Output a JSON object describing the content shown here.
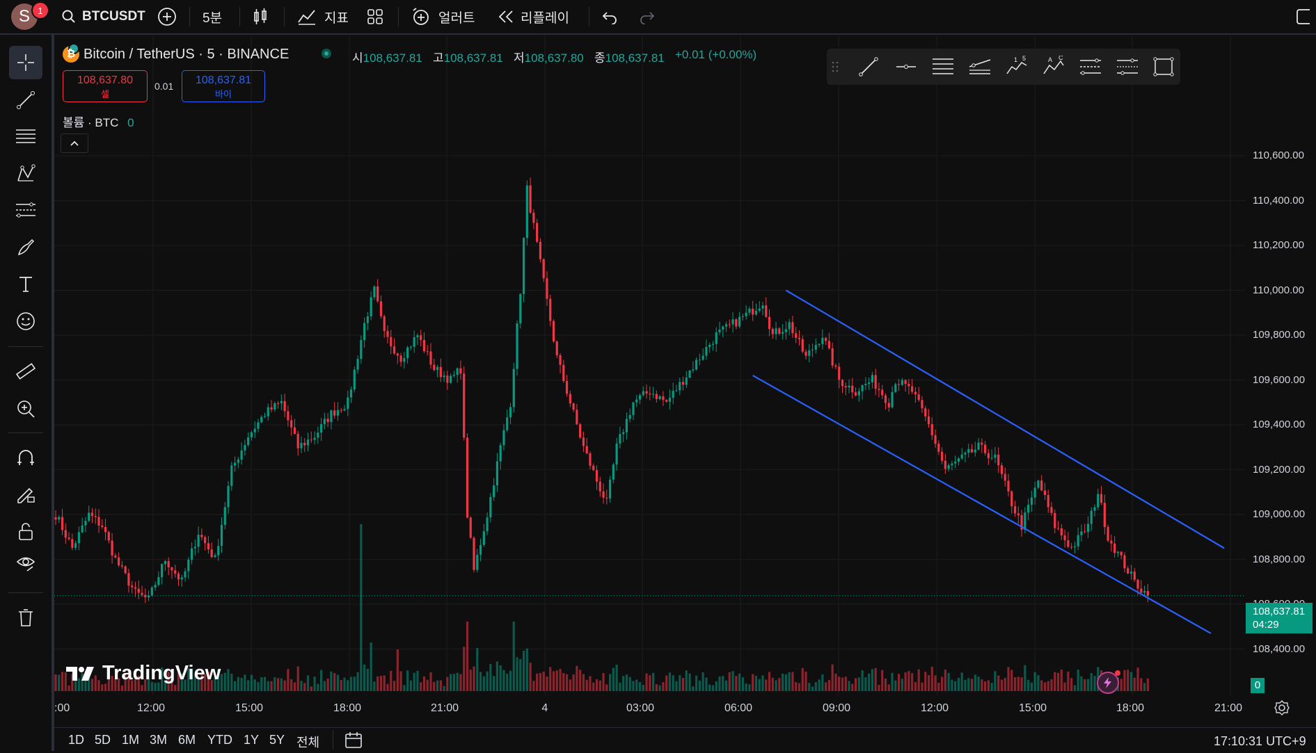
{
  "topbar": {
    "avatar_initial": "S",
    "notification_count": "1",
    "symbol": "BTCUSDT",
    "interval": "5분",
    "indicators_label": "지표",
    "alert_label": "얼러트",
    "replay_label": "리플레이"
  },
  "legend": {
    "title": "Bitcoin / TetherUS · 5 · BINANCE",
    "open_key": "시",
    "open": "108,637.81",
    "high_key": "고",
    "high": "108,637.81",
    "low_key": "저",
    "low": "108,637.80",
    "close_key": "종",
    "close": "108,637.81",
    "change": "+0.01 (+0.00%)",
    "sell_price": "108,637.80",
    "sell_label": "셀",
    "spread": "0.01",
    "buy_price": "108,637.81",
    "buy_label": "바이",
    "volume_label": "볼륨 · BTC",
    "volume_value": "0"
  },
  "chart_data": {
    "type": "candlestick",
    "title": "Bitcoin / TetherUS · 5 · BINANCE",
    "y_ticks": [
      108400,
      108600,
      108800,
      109000,
      109200,
      109400,
      109600,
      109800,
      110000,
      110200,
      110400,
      110600
    ],
    "y_range": [
      108350,
      110700
    ],
    "x_ticks": [
      "12:00",
      "15:00",
      "18:00",
      "21:00",
      "4",
      "03:00",
      "06:00",
      "09:00",
      "12:00",
      "15:00",
      "18:00",
      "21:00"
    ],
    "keyframes": [
      [
        0,
        109000
      ],
      [
        5,
        108850
      ],
      [
        10,
        109000
      ],
      [
        14,
        108950
      ],
      [
        18,
        108800
      ],
      [
        24,
        108650
      ],
      [
        28,
        108620
      ],
      [
        33,
        108800
      ],
      [
        38,
        108700
      ],
      [
        43,
        108920
      ],
      [
        48,
        108800
      ],
      [
        53,
        109200
      ],
      [
        58,
        109350
      ],
      [
        63,
        109450
      ],
      [
        68,
        109500
      ],
      [
        73,
        109300
      ],
      [
        78,
        109350
      ],
      [
        83,
        109450
      ],
      [
        88,
        109500
      ],
      [
        93,
        109850
      ],
      [
        96,
        110000
      ],
      [
        99,
        109800
      ],
      [
        104,
        109700
      ],
      [
        109,
        109800
      ],
      [
        114,
        109650
      ],
      [
        119,
        109600
      ],
      [
        122,
        109650
      ],
      [
        124,
        109000
      ],
      [
        126,
        108750
      ],
      [
        130,
        109000
      ],
      [
        134,
        109300
      ],
      [
        137,
        109500
      ],
      [
        140,
        110000
      ],
      [
        142,
        110450
      ],
      [
        145,
        110200
      ],
      [
        148,
        109950
      ],
      [
        151,
        109700
      ],
      [
        155,
        109500
      ],
      [
        159,
        109300
      ],
      [
        163,
        109150
      ],
      [
        166,
        109050
      ],
      [
        169,
        109300
      ],
      [
        174,
        109500
      ],
      [
        179,
        109550
      ],
      [
        184,
        109500
      ],
      [
        189,
        109600
      ],
      [
        194,
        109700
      ],
      [
        199,
        109800
      ],
      [
        204,
        109850
      ],
      [
        209,
        109900
      ],
      [
        213,
        109950
      ],
      [
        216,
        109800
      ],
      [
        221,
        109850
      ],
      [
        226,
        109700
      ],
      [
        231,
        109800
      ],
      [
        236,
        109600
      ],
      [
        241,
        109550
      ],
      [
        246,
        109600
      ],
      [
        251,
        109500
      ],
      [
        253,
        109600
      ],
      [
        258,
        109550
      ],
      [
        263,
        109400
      ],
      [
        268,
        109200
      ],
      [
        273,
        109250
      ],
      [
        278,
        109300
      ],
      [
        283,
        109250
      ],
      [
        288,
        109050
      ],
      [
        291,
        108950
      ],
      [
        296,
        109150
      ],
      [
        301,
        108950
      ],
      [
        306,
        108850
      ],
      [
        311,
        108950
      ],
      [
        314,
        109100
      ],
      [
        317,
        108900
      ],
      [
        321,
        108800
      ],
      [
        325,
        108700
      ],
      [
        329,
        108637.81
      ]
    ],
    "last_price": "108,637.81",
    "countdown": "04:29",
    "volume_zero": "0",
    "channel": {
      "upper": [
        [
          220,
          110000
        ],
        [
          352,
          108850
        ]
      ],
      "lower": [
        [
          210,
          109620
        ],
        [
          348,
          108470
        ]
      ]
    }
  },
  "range_buttons": [
    "1D",
    "5D",
    "1M",
    "3M",
    "6M",
    "YTD",
    "1Y",
    "5Y",
    "전체"
  ],
  "status": {
    "clock": "17:10:31 UTC+9"
  },
  "watermark": "TradingView"
}
